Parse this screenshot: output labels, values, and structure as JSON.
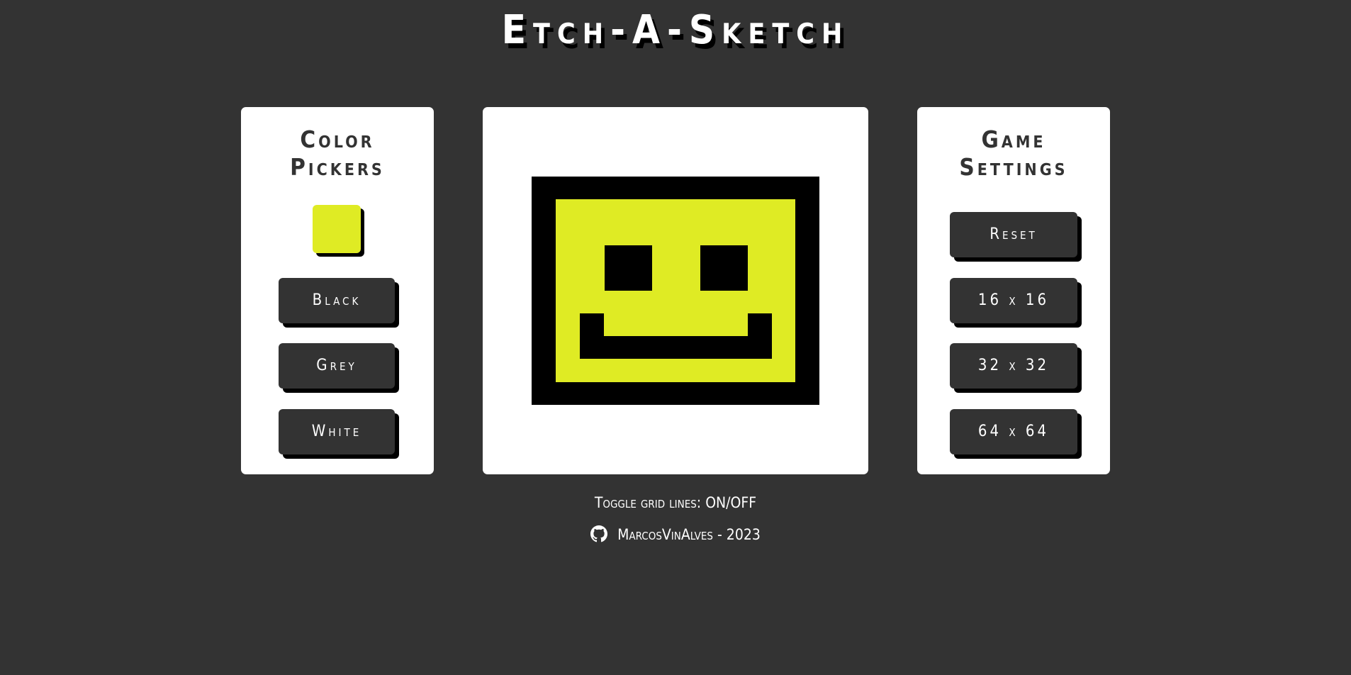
{
  "app": {
    "title": "Etch-A-Sketch"
  },
  "colors": {
    "background": "#333333",
    "card": "#ffffff",
    "selected_color": "#dfeb24",
    "pixel_black": "#000000"
  },
  "color_panel": {
    "heading_line1": "Color",
    "heading_line2": "Pickers",
    "buttons": [
      {
        "label": "Black"
      },
      {
        "label": "Grey"
      },
      {
        "label": "White"
      }
    ]
  },
  "settings_panel": {
    "heading_line1": "Game",
    "heading_line2": "Settings",
    "buttons": [
      {
        "label": "Reset"
      },
      {
        "label": "16 x 16"
      },
      {
        "label": "32 x 32"
      },
      {
        "label": "64 x 64"
      }
    ]
  },
  "board": {
    "drawing": "smiley-face"
  },
  "toggle": {
    "prefix": "Toggle grid lines: ",
    "link": "ON/OFF"
  },
  "footer": {
    "icon": "github-icon",
    "text": "MarcosVinAlves - 2023"
  }
}
